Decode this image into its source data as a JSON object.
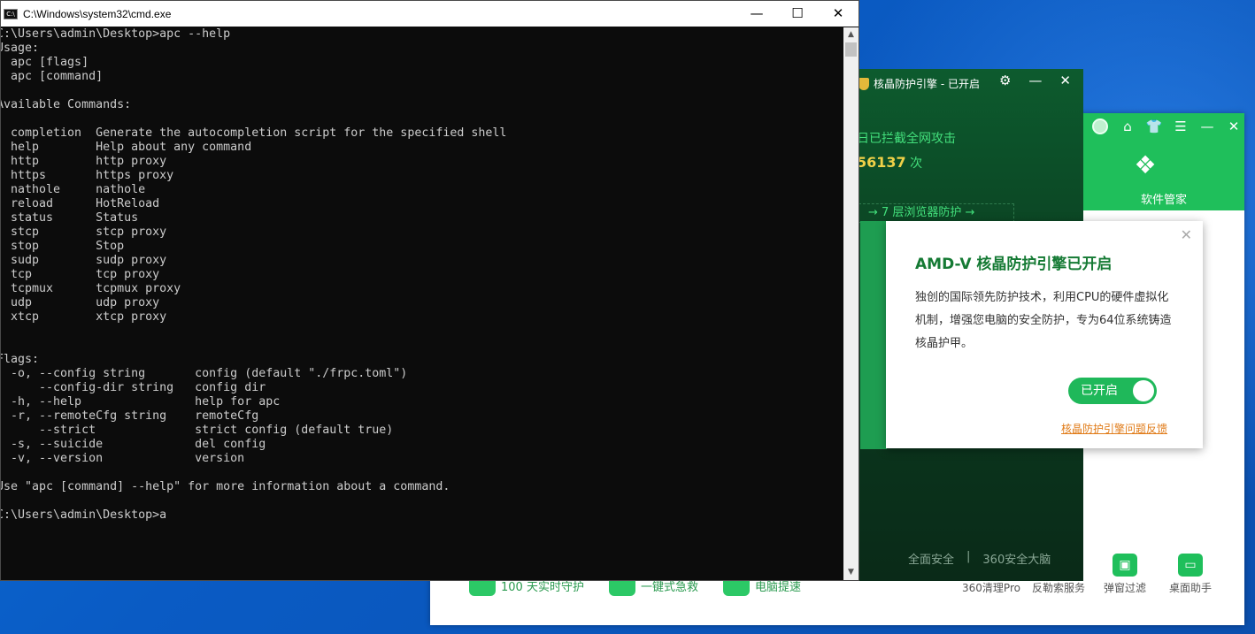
{
  "cmd": {
    "title": "C:\\Windows\\system32\\cmd.exe",
    "app_icon": "C:\\",
    "minimize": "—",
    "maximize": "☐",
    "close": "✕",
    "lines": [
      "C:\\Users\\admin\\Desktop>apc --help",
      "Usage:",
      "  apc [flags]",
      "  apc [command]",
      "",
      "Available Commands:",
      "",
      "  completion  Generate the autocompletion script for the specified shell",
      "  help        Help about any command",
      "  http        http proxy",
      "  https       https proxy",
      "  nathole     nathole",
      "  reload      HotReload",
      "  status      Status",
      "  stcp        stcp proxy",
      "  stop        Stop",
      "  sudp        sudp proxy",
      "  tcp         tcp proxy",
      "  tcpmux      tcpmux proxy",
      "  udp         udp proxy",
      "  xtcp        xtcp proxy",
      "",
      "",
      "Flags:",
      "  -o, --config string       config (default \"./frpc.toml\")",
      "      --config-dir string   config dir",
      "  -h, --help                help for apc",
      "  -r, --remoteCfg string    remoteCfg",
      "      --strict              strict config (default true)",
      "  -s, --suicide             del config",
      "  -v, --version             version",
      "",
      "Use \"apc [command] --help\" for more information about a command.",
      "",
      "C:\\Users\\admin\\Desktop>a"
    ]
  },
  "kernel": {
    "title": "核晶防护引擎 - 已开启",
    "settings_icon": "⚙",
    "minimize": "—",
    "close": "✕",
    "intercept_label": "日已拦截全网攻击",
    "intercept_count": "56137",
    "intercept_unit": " 次",
    "layer_text": "→  7 层浏览器防护 →",
    "footer_left": "全面安全",
    "footer_sep": "|",
    "footer_right": "360安全大脑"
  },
  "main360": {
    "toolbar_icons": [
      "⌂",
      "👕",
      "☰",
      "—",
      "✕"
    ],
    "softmgr_icon": "❖",
    "softmgr_label": "软件管家",
    "bottom_left": [
      {
        "label": "100 天实时守护"
      },
      {
        "label": "一键式急救"
      },
      {
        "label": "电脑提速"
      }
    ],
    "tools": [
      {
        "label": "360清理Pro",
        "icon": ""
      },
      {
        "label": "反勒索服务",
        "icon": ""
      },
      {
        "label": "弹窗过滤",
        "icon": "▣"
      },
      {
        "label": "桌面助手",
        "icon": "▭"
      }
    ]
  },
  "popup": {
    "close": "✕",
    "title": "AMD-V 核晶防护引擎已开启",
    "body": "独创的国际领先防护技术，利用CPU的硬件虚拟化机制，增强您电脑的安全防护，专为64位系统铸造核晶护甲。",
    "toggle_label": "已开启",
    "toggle_on": true,
    "feedback_link": "核晶防护引擎问题反馈"
  }
}
